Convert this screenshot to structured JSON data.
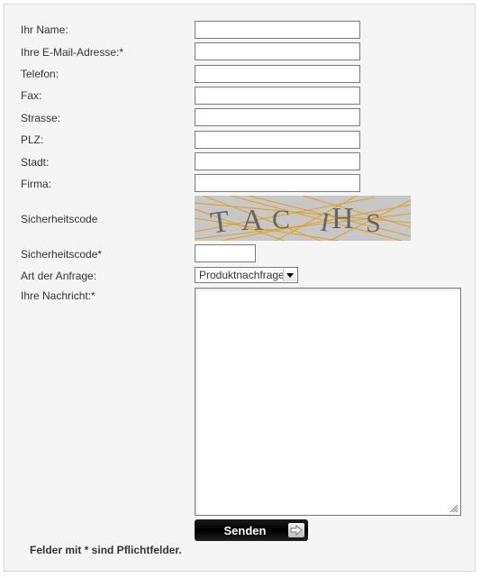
{
  "form": {
    "fields": [
      {
        "label": "Ihr Name:",
        "value": ""
      },
      {
        "label": "Ihre E-Mail-Adresse:*",
        "value": ""
      },
      {
        "label": "Telefon:",
        "value": ""
      },
      {
        "label": "Fax:",
        "value": ""
      },
      {
        "label": "Strasse:",
        "value": ""
      },
      {
        "label": "PLZ:",
        "value": ""
      },
      {
        "label": "Stadt:",
        "value": ""
      },
      {
        "label": "Firma:",
        "value": ""
      }
    ],
    "captcha_label": "Sicherheitscode",
    "captcha_text": "TAC HS",
    "captcha_input_label": "Sicherheitscode*",
    "captcha_input_value": "",
    "request_type_label": "Art der Anfrage:",
    "request_type_selected": "Produktnachfrage",
    "message_label": "Ihre Nachricht:*",
    "message_value": "",
    "send_label": "Senden",
    "required_note": "Felder mit * sind Pflichtfelder."
  },
  "icons": {
    "send_arrow": "arrow-right-icon",
    "select_arrow": "chevron-down-icon",
    "resize": "resize-grip-icon"
  },
  "colors": {
    "panel_bg": "#f5f5f5",
    "captcha_bg": "#c7c7c7",
    "captcha_lines": "#e0a020",
    "button_bg": "#000000"
  }
}
